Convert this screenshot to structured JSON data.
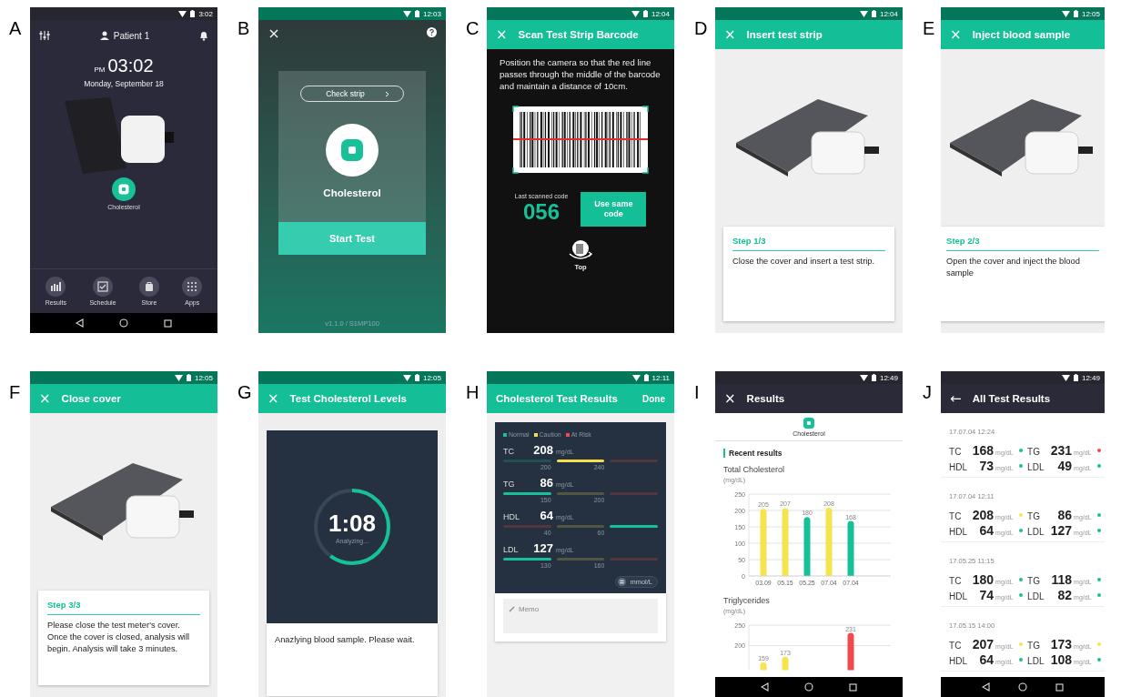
{
  "panels": [
    {
      "label": "A",
      "kind": "home",
      "status_time": "3:02",
      "patient": "Patient 1",
      "ampm": "PM",
      "time": "03:02",
      "date": "Monday, September 18",
      "app_label": "Cholesterol",
      "dock": [
        {
          "label": "Results"
        },
        {
          "label": "Schedule"
        },
        {
          "label": "Store"
        },
        {
          "label": "Apps"
        }
      ]
    },
    {
      "label": "B",
      "kind": "start",
      "status_time": "12:03",
      "check_button": "Check strip",
      "title": "Cholesterol",
      "start_button": "Start Test",
      "version": "v1.1.0 / S1MP100"
    },
    {
      "label": "C",
      "kind": "scan",
      "status_time": "12:04",
      "header_icon": "×",
      "title": "Scan Test Strip Barcode",
      "instructions": "Position the camera so that the red line passes through the middle of the barcode and maintain a distance of 10cm.",
      "last_code_label": "Last scanned code",
      "last_code": "056",
      "same_code_button": "Use same code",
      "rotate_label": "Top"
    },
    {
      "label": "D",
      "kind": "step",
      "status_time": "12:04",
      "header_icon": "×",
      "title": "Insert test strip",
      "step": "Step 1/3",
      "text": "Close the cover and insert a test strip."
    },
    {
      "label": "E",
      "kind": "step",
      "status_time": "12:05",
      "header_icon": "×",
      "title": "Inject blood sample",
      "step": "Step 2/3",
      "text": "Open the cover and inject the blood sample"
    },
    {
      "label": "F",
      "kind": "step",
      "status_time": "12:05",
      "header_icon": "×",
      "title": "Close cover",
      "step": "Step 3/3",
      "text": "Please close the test meter's cover. Once the cover is closed, analysis will begin. Analysis will take 3 minutes."
    },
    {
      "label": "G",
      "kind": "timer",
      "status_time": "12:05",
      "header_icon": "×",
      "title": "Test Cholesterol Levels",
      "time": "1:08",
      "state": "Analyzing...",
      "level": 0.6,
      "message": "Anazlying blood sample. Please wait."
    },
    {
      "label": "H",
      "kind": "results",
      "status_time": "12:11",
      "title": "Cholesterol Test Results",
      "action": "Done",
      "legend": [
        {
          "label": "Normal",
          "color": "#16c197"
        },
        {
          "label": "Caution",
          "color": "#f3df4c"
        },
        {
          "label": "At Risk",
          "color": "#ef4a4d"
        }
      ],
      "metrics": [
        {
          "name": "TC",
          "value": "208",
          "unit": "mg/dL",
          "segments": [
            {
              "color": "#235050"
            },
            {
              "color": "#f3df4c"
            },
            {
              "color": "#523640"
            }
          ],
          "ticks": [
            "200",
            "240"
          ]
        },
        {
          "name": "TG",
          "value": "86",
          "unit": "mg/dL",
          "segments": [
            {
              "color": "#16c197"
            },
            {
              "color": "#535640"
            },
            {
              "color": "#523640"
            }
          ],
          "ticks": [
            "150",
            "200"
          ]
        },
        {
          "name": "HDL",
          "value": "64",
          "unit": "mg/dL",
          "segments": [
            {
              "color": "#523640"
            },
            {
              "color": "#535640"
            },
            {
              "color": "#16c197"
            }
          ],
          "ticks": [
            "40",
            "60"
          ]
        },
        {
          "name": "LDL",
          "value": "127",
          "unit": "mg/dL",
          "segments": [
            {
              "color": "#16c197"
            },
            {
              "color": "#535640"
            },
            {
              "color": "#523640"
            }
          ],
          "ticks": [
            "130",
            "160"
          ]
        }
      ],
      "unit_toggle": "mmol/L",
      "memo_placeholder": "Memo"
    },
    {
      "label": "I",
      "kind": "history",
      "status_time": "12:49",
      "header_icon": "×",
      "title": "Results",
      "app_label": "Cholesterol",
      "section": "Recent results",
      "charts": [
        {
          "title": "Total Cholesterol",
          "unit": "(mg/dL)",
          "chart_data": {
            "type": "bar",
            "categories": [
              "03.09",
              "05.15",
              "05.25",
              "07.04",
              "07.04"
            ],
            "series": [
              {
                "color": "#f6e44e",
                "values": [
                  205,
                  207,
                  null,
                  208,
                  null
                ]
              },
              {
                "color": "#16c197",
                "values": [
                  null,
                  null,
                  180,
                  null,
                  168
                ]
              }
            ],
            "ylim": [
              0,
              250
            ],
            "yticks": [
              0,
              50,
              100,
              150,
              200,
              250
            ],
            "grid": true,
            "data_labels": true
          }
        },
        {
          "title": "Triglycerides",
          "unit": "(mg/dL)",
          "chart_data": {
            "type": "bar",
            "series": [
              {
                "color": "#f6e44e",
                "values": [
                  159,
                  173,
                  null,
                  null,
                  null
                ]
              },
              {
                "color": "#ef4a4d",
                "values": [
                  null,
                  null,
                  null,
                  null,
                  231
                ]
              }
            ],
            "ylim": [
              140,
              250
            ],
            "yticks": [
              200,
              250
            ],
            "grid": true,
            "data_labels": true
          }
        }
      ]
    },
    {
      "label": "J",
      "kind": "all_results",
      "status_time": "12:49",
      "header_icon": "←",
      "title": "All Test Results",
      "entries": [
        {
          "datetime": "17.07.04 12:24",
          "metrics": [
            {
              "name": "TC",
              "value": "168",
              "unit": "mg/dL",
              "color": "#16c197"
            },
            {
              "name": "TG",
              "value": "231",
              "unit": "mg/dL",
              "color": "#ef4a4d"
            },
            {
              "name": "HDL",
              "value": "73",
              "unit": "mg/dL",
              "color": "#16c197"
            },
            {
              "name": "LDL",
              "value": "49",
              "unit": "mg/dL",
              "color": "#16c197"
            }
          ]
        },
        {
          "datetime": "17.07.04 12:11",
          "metrics": [
            {
              "name": "TC",
              "value": "208",
              "unit": "mg/dL",
              "color": "#f6e44e"
            },
            {
              "name": "TG",
              "value": "86",
              "unit": "mg/dL",
              "color": "#16c197"
            },
            {
              "name": "HDL",
              "value": "64",
              "unit": "mg/dL",
              "color": "#16c197"
            },
            {
              "name": "LDL",
              "value": "127",
              "unit": "mg/dL",
              "color": "#16c197"
            }
          ]
        },
        {
          "datetime": "17.05.25 11:15",
          "metrics": [
            {
              "name": "TC",
              "value": "180",
              "unit": "mg/dL",
              "color": "#16c197"
            },
            {
              "name": "TG",
              "value": "118",
              "unit": "mg/dL",
              "color": "#16c197"
            },
            {
              "name": "HDL",
              "value": "74",
              "unit": "mg/dL",
              "color": "#16c197"
            },
            {
              "name": "LDL",
              "value": "82",
              "unit": "mg/dL",
              "color": "#16c197"
            }
          ]
        },
        {
          "datetime": "17.05.15 14:00",
          "metrics": [
            {
              "name": "TC",
              "value": "207",
              "unit": "mg/dL",
              "color": "#f6e44e"
            },
            {
              "name": "TG",
              "value": "173",
              "unit": "mg/dL",
              "color": "#f6e44e"
            },
            {
              "name": "HDL",
              "value": "64",
              "unit": "mg/dL",
              "color": "#16c197"
            },
            {
              "name": "LDL",
              "value": "108",
              "unit": "mg/dL",
              "color": "#16c197"
            }
          ]
        }
      ]
    }
  ]
}
